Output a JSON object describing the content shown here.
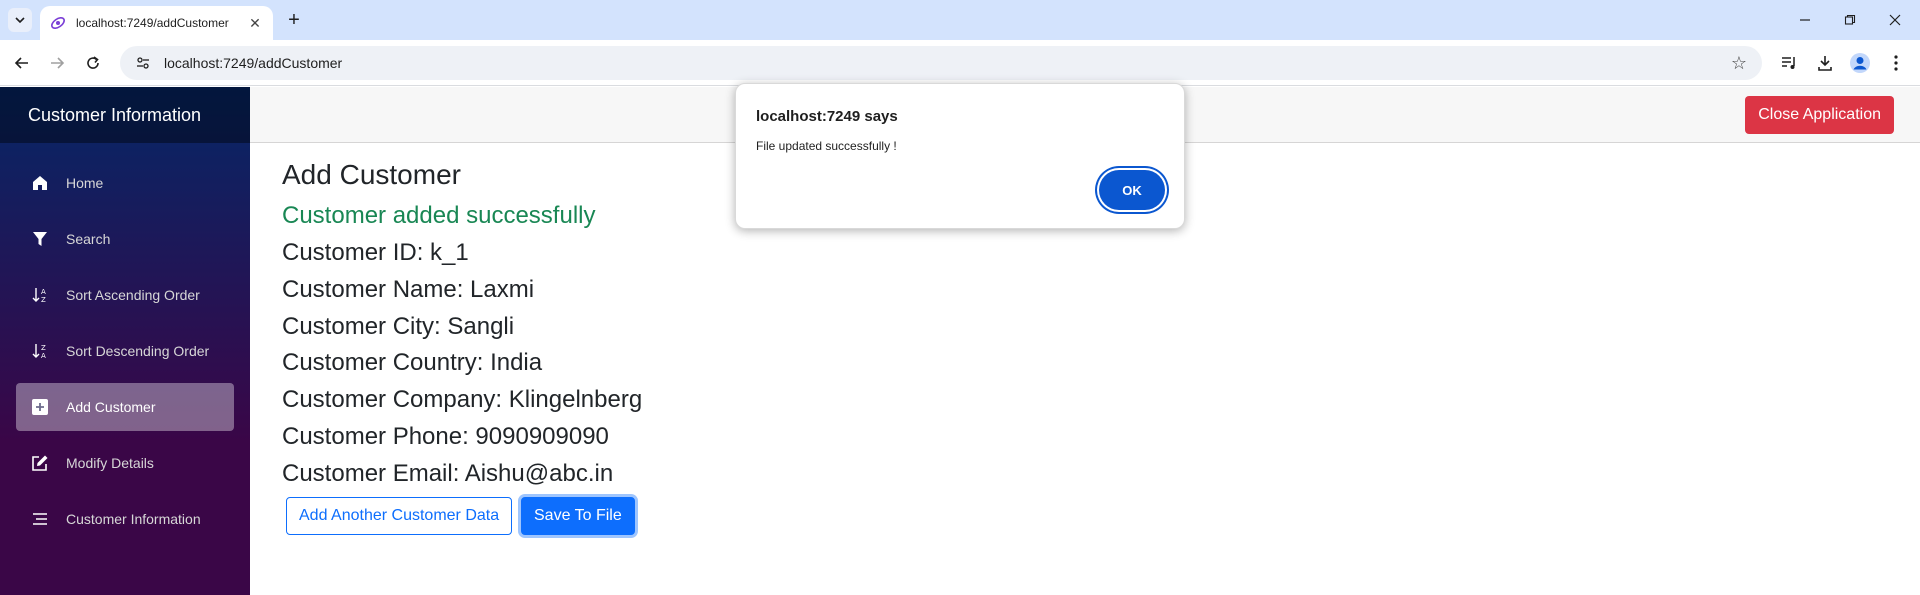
{
  "browser": {
    "tab_title": "localhost:7249/addCustomer",
    "url": "localhost:7249/addCustomer"
  },
  "app": {
    "brand": "Customer Information",
    "close_label": "Close Application"
  },
  "sidebar": {
    "items": [
      {
        "label": "Home",
        "icon": "home-icon"
      },
      {
        "label": "Search",
        "icon": "filter-icon"
      },
      {
        "label": "Sort Ascending Order",
        "icon": "sort-ascending-icon"
      },
      {
        "label": "Sort Descending Order",
        "icon": "sort-descending-icon"
      },
      {
        "label": "Add Customer",
        "icon": "plus-square-icon",
        "active": true
      },
      {
        "label": "Modify Details",
        "icon": "edit-icon"
      },
      {
        "label": "Customer Information",
        "icon": "list-icon"
      }
    ]
  },
  "main": {
    "heading": "Add Customer",
    "success": "Customer added successfully",
    "details": [
      "Customer ID: k_1",
      "Customer Name: Laxmi",
      "Customer City: Sangli",
      "Customer Country: India",
      "Customer Company: Klingelnberg",
      "Customer Phone: 9090909090",
      "Customer Email: Aishu@abc.in"
    ],
    "add_another_label": "Add Another Customer Data",
    "save_label": "Save To File"
  },
  "dialog": {
    "title": "localhost:7249 says",
    "message": "File updated successfully !",
    "ok_label": "OK"
  },
  "colors": {
    "success": "#198754",
    "primary": "#0d6efd",
    "danger": "#dc3545",
    "chrome_accent": "#0b57d0"
  }
}
